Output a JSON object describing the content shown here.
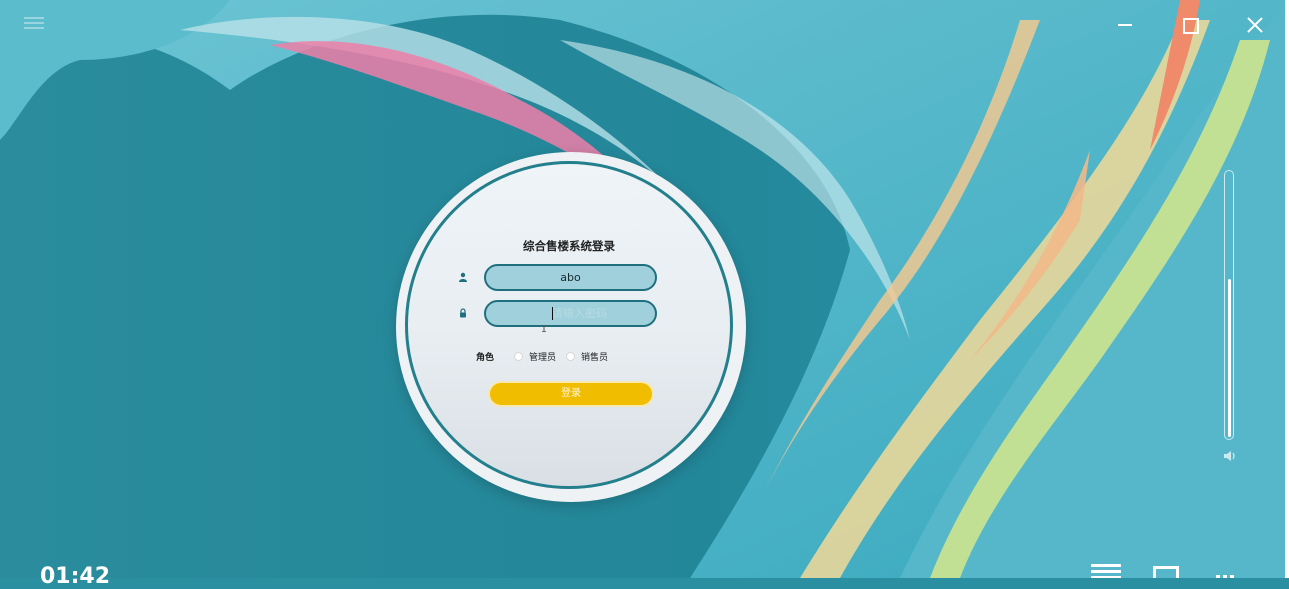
{
  "login": {
    "title": "综合售楼系统登录",
    "username_value": "abo",
    "password_placeholder": "请输入密码",
    "role_label": "角色",
    "role_options": [
      "管理员",
      "销售员"
    ],
    "submit_label": "登录"
  },
  "icons": {
    "menu": "menu-icon",
    "minimize": "minimize-icon",
    "maximize": "maximize-icon",
    "close": "close-icon",
    "user": "user-icon",
    "lock": "lock-icon",
    "volume": "volume-icon",
    "playlist": "playlist-icon",
    "screen": "screen-icon",
    "grid": "grid-icon"
  },
  "player": {
    "time": "01:42",
    "volume_level": 0.6
  },
  "colors": {
    "field_fill": "#9fd0dc",
    "field_border": "#1f6f7e",
    "ring": "#237f8c",
    "button": "#f1bd00"
  }
}
